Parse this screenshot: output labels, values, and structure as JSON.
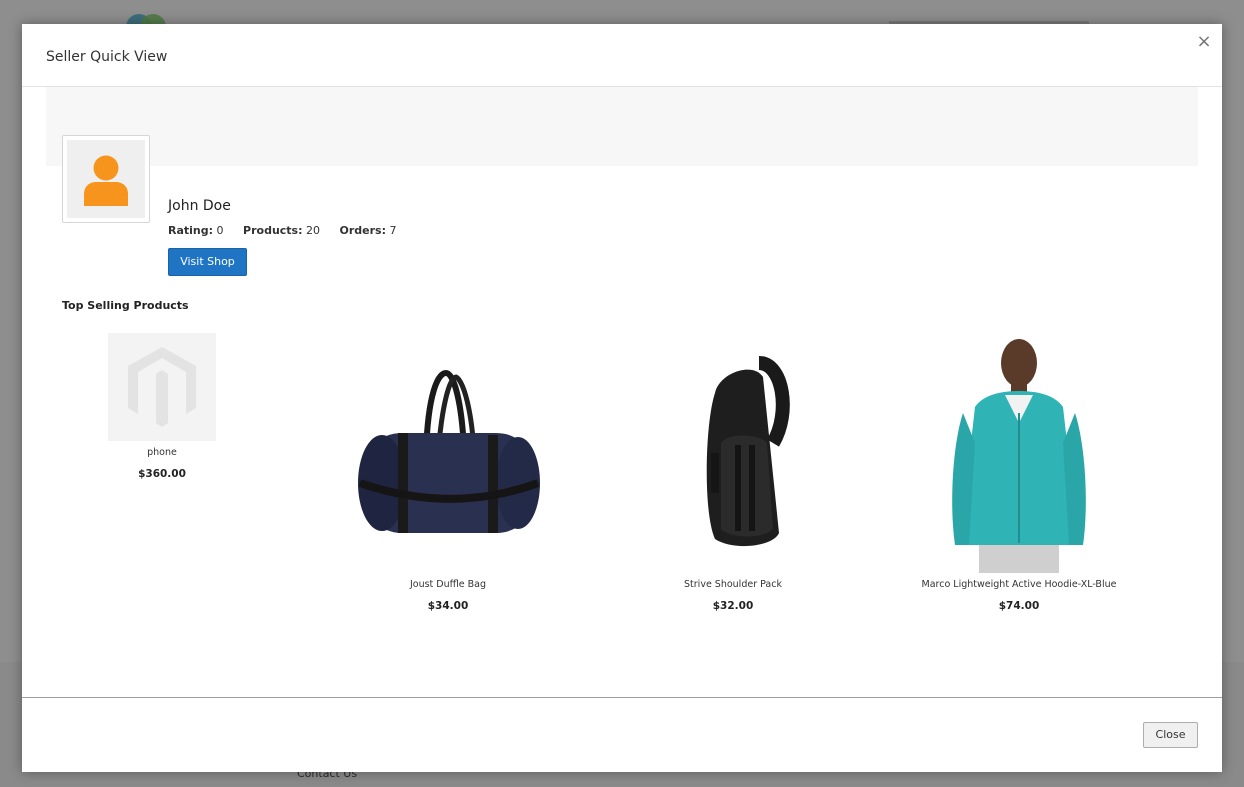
{
  "background": {
    "footer_link": "Contact Us"
  },
  "modal": {
    "title": "Seller Quick View",
    "close_x": "×",
    "close_button": "Close"
  },
  "seller": {
    "name": "John Doe",
    "rating_label": "Rating:",
    "rating_value": "0",
    "products_label": "Products:",
    "products_value": "20",
    "orders_label": "Orders:",
    "orders_value": "7",
    "visit_shop": "Visit Shop",
    "avatar_icon": "user-avatar-icon"
  },
  "top_selling": {
    "title": "Top Selling Products",
    "products": [
      {
        "name": "phone",
        "price": "$360.00",
        "image_icon": "magento-placeholder-icon"
      },
      {
        "name": "Joust Duffle Bag",
        "price": "$34.00",
        "image_icon": "duffle-bag-image"
      },
      {
        "name": "Strive Shoulder Pack",
        "price": "$32.00",
        "image_icon": "shoulder-pack-image"
      },
      {
        "name": "Marco Lightweight Active Hoodie-XL-Blue",
        "price": "$74.00",
        "image_icon": "hoodie-model-image"
      }
    ]
  },
  "colors": {
    "accent": "#1f74c4",
    "avatar": "#f7941d",
    "hoodie": "#2fb3b5"
  }
}
